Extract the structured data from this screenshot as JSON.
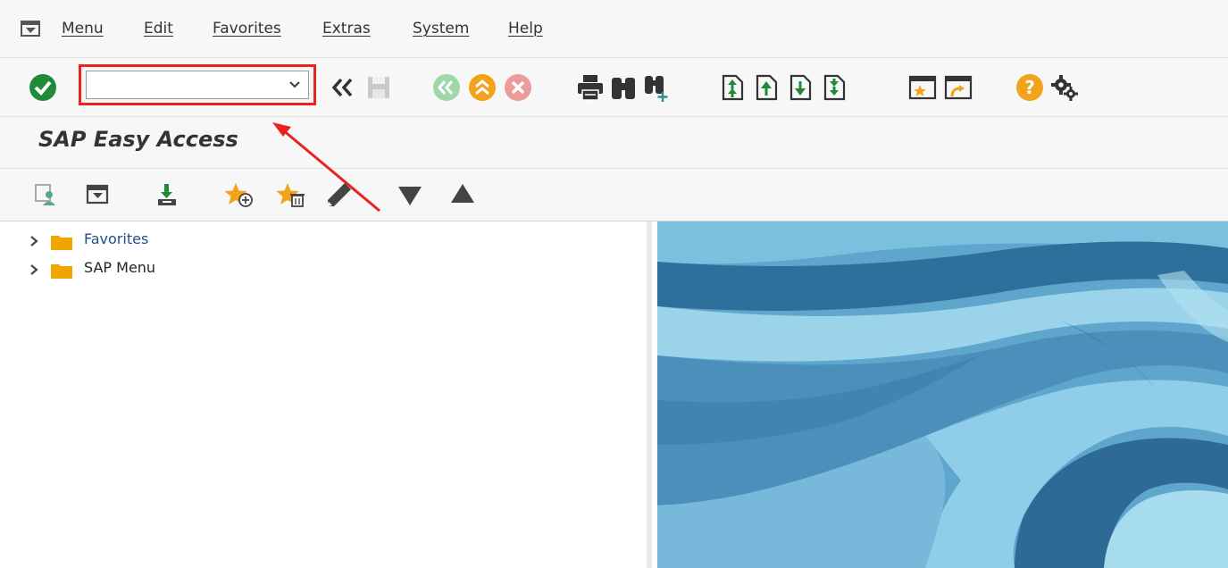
{
  "menubar": {
    "items": [
      {
        "label": "Menu"
      },
      {
        "label": "Edit"
      },
      {
        "label": "Favorites"
      },
      {
        "label": "Extras"
      },
      {
        "label": "System"
      },
      {
        "label": "Help"
      }
    ]
  },
  "toolbar": {
    "command_field": {
      "value": "",
      "placeholder": ""
    },
    "icons": [
      "enter-icon",
      "back-double-icon",
      "save-icon",
      "back-icon",
      "exit-icon",
      "cancel-icon",
      "print-icon",
      "find-icon",
      "find-next-icon",
      "first-page-icon",
      "previous-page-icon",
      "next-page-icon",
      "last-page-icon",
      "create-session-icon",
      "generate-shortcut-icon",
      "help-icon",
      "customize-layout-icon"
    ]
  },
  "title": {
    "text": "SAP Easy Access"
  },
  "app_toolbar": {
    "icons": [
      "user-menu-icon",
      "sap-menu-icon",
      "other-menu-icon",
      "add-favorite-icon",
      "delete-favorite-icon",
      "change-favorite-icon",
      "move-down-icon",
      "move-up-icon"
    ]
  },
  "tree": {
    "nodes": [
      {
        "label": "Favorites"
      },
      {
        "label": "SAP Menu"
      }
    ]
  },
  "colors": {
    "accent_red": "#e8231e",
    "enter_green": "#1f8a3a",
    "nav_orange": "#f2a31b",
    "folder_yellow": "#f0a500",
    "favorites_text": "#1f4e8c"
  }
}
